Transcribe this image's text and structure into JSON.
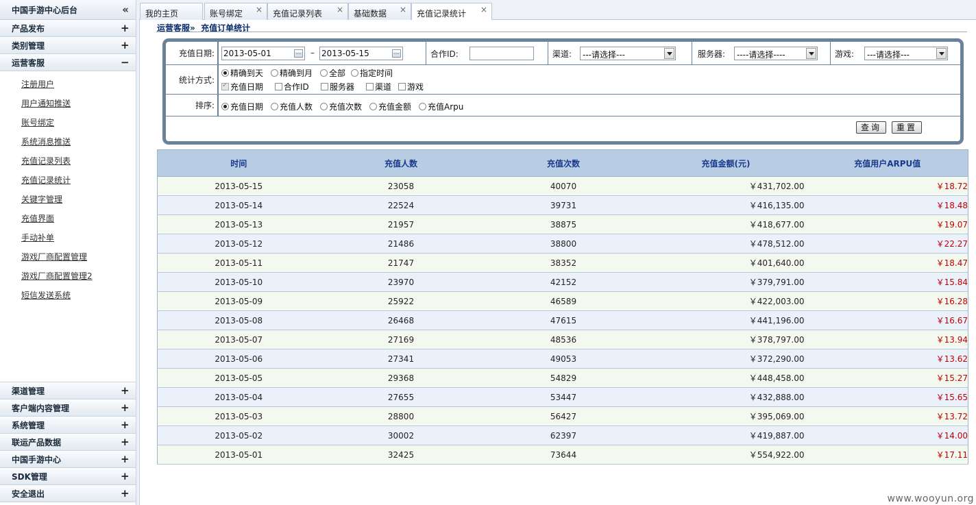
{
  "sidebar": {
    "title": "中国手游中心后台",
    "collapse_glyph": "«",
    "sections_top": [
      {
        "label": "产品发布",
        "toggle": "+"
      },
      {
        "label": "类别管理",
        "toggle": "+"
      },
      {
        "label": "运营客服",
        "toggle": "−"
      }
    ],
    "items": [
      "注册用户",
      "用户通知推送",
      "账号绑定",
      "系统消息推送",
      "充值记录列表",
      "充值记录统计",
      "关键字管理",
      "充值界面",
      "手动补单",
      "游戏厂商配置管理",
      "游戏厂商配置管理2",
      "短信发送系统"
    ],
    "sections_bottom": [
      {
        "label": "渠道管理",
        "toggle": "+"
      },
      {
        "label": "客户端内容管理",
        "toggle": "+"
      },
      {
        "label": "系统管理",
        "toggle": "+"
      },
      {
        "label": "联运产品数据",
        "toggle": "+"
      },
      {
        "label": "中国手游中心",
        "toggle": "+"
      },
      {
        "label": "SDK管理",
        "toggle": "+"
      },
      {
        "label": "安全退出",
        "toggle": "+"
      }
    ]
  },
  "tabs": [
    {
      "label": "我的主页",
      "closable": false
    },
    {
      "label": "账号绑定",
      "closable": true
    },
    {
      "label": "充值记录列表",
      "closable": true
    },
    {
      "label": "基础数据",
      "closable": true
    },
    {
      "label": "充值记录统计",
      "closable": true,
      "active": true
    }
  ],
  "close_glyph": "×",
  "breadcrumb": {
    "parent": "运营客服",
    "separator": "»",
    "current": "充值订单统计"
  },
  "filters": {
    "date_label": "充值日期:",
    "date_from": "2013-05-01",
    "date_sep": "–",
    "date_to": "2013-05-15",
    "partner_label": "合作ID:",
    "partner_value": "",
    "channel_label": "渠道:",
    "channel_value": "---请选择---",
    "server_label": "服务器:",
    "server_value": "----请选择----",
    "game_label": "游戏:",
    "game_value": "---请选择---",
    "stat_label": "统计方式:",
    "stat_modes": [
      "精确到天",
      "精确到月",
      "全部",
      "指定时间"
    ],
    "stat_mode_selected": "精确到天",
    "group_fields": [
      {
        "label": "充值日期",
        "checked": true,
        "disabled": true
      },
      {
        "label": "合作ID",
        "checked": false
      },
      {
        "label": "服务器",
        "checked": false
      },
      {
        "label": "渠道",
        "checked": false
      },
      {
        "label": "游戏",
        "checked": false
      }
    ],
    "sort_label": "排序:",
    "sort_options": [
      "充值日期",
      "充值人数",
      "充值次数",
      "充值金额",
      "充值Arpu"
    ],
    "sort_selected": "充值日期",
    "query_button": "查询",
    "reset_button": "重置"
  },
  "table": {
    "columns": [
      "时间",
      "充值人数",
      "充值次数",
      "充值金额(元)",
      "充值用户ARPU值"
    ],
    "rows": [
      [
        "2013-05-15",
        "23058",
        "40070",
        "￥431,702.00",
        "￥18.72"
      ],
      [
        "2013-05-14",
        "22524",
        "39731",
        "￥416,135.00",
        "￥18.48"
      ],
      [
        "2013-05-13",
        "21957",
        "38875",
        "￥418,677.00",
        "￥19.07"
      ],
      [
        "2013-05-12",
        "21486",
        "38800",
        "￥478,512.00",
        "￥22.27"
      ],
      [
        "2013-05-11",
        "21747",
        "38352",
        "￥401,640.00",
        "￥18.47"
      ],
      [
        "2013-05-10",
        "23970",
        "42152",
        "￥379,791.00",
        "￥15.84"
      ],
      [
        "2013-05-09",
        "25922",
        "46589",
        "￥422,003.00",
        "￥16.28"
      ],
      [
        "2013-05-08",
        "26468",
        "47615",
        "￥441,196.00",
        "￥16.67"
      ],
      [
        "2013-05-07",
        "27169",
        "48536",
        "￥378,797.00",
        "￥13.94"
      ],
      [
        "2013-05-06",
        "27341",
        "49053",
        "￥372,290.00",
        "￥13.62"
      ],
      [
        "2013-05-05",
        "29368",
        "54829",
        "￥448,458.00",
        "￥15.27"
      ],
      [
        "2013-05-04",
        "27655",
        "53447",
        "￥432,888.00",
        "￥15.65"
      ],
      [
        "2013-05-03",
        "28800",
        "56427",
        "￥395,069.00",
        "￥13.72"
      ],
      [
        "2013-05-02",
        "30002",
        "62397",
        "￥419,887.00",
        "￥14.00"
      ],
      [
        "2013-05-01",
        "32425",
        "73644",
        "￥554,922.00",
        "￥17.11"
      ]
    ]
  },
  "colors": {
    "header_bg": "#b8cde4",
    "header_text": "#1a3a8c",
    "arpu_text": "#c00000",
    "row_odd": "#f3f9ef",
    "row_even": "#eaf1fa"
  },
  "watermark": "www.wooyun.org"
}
